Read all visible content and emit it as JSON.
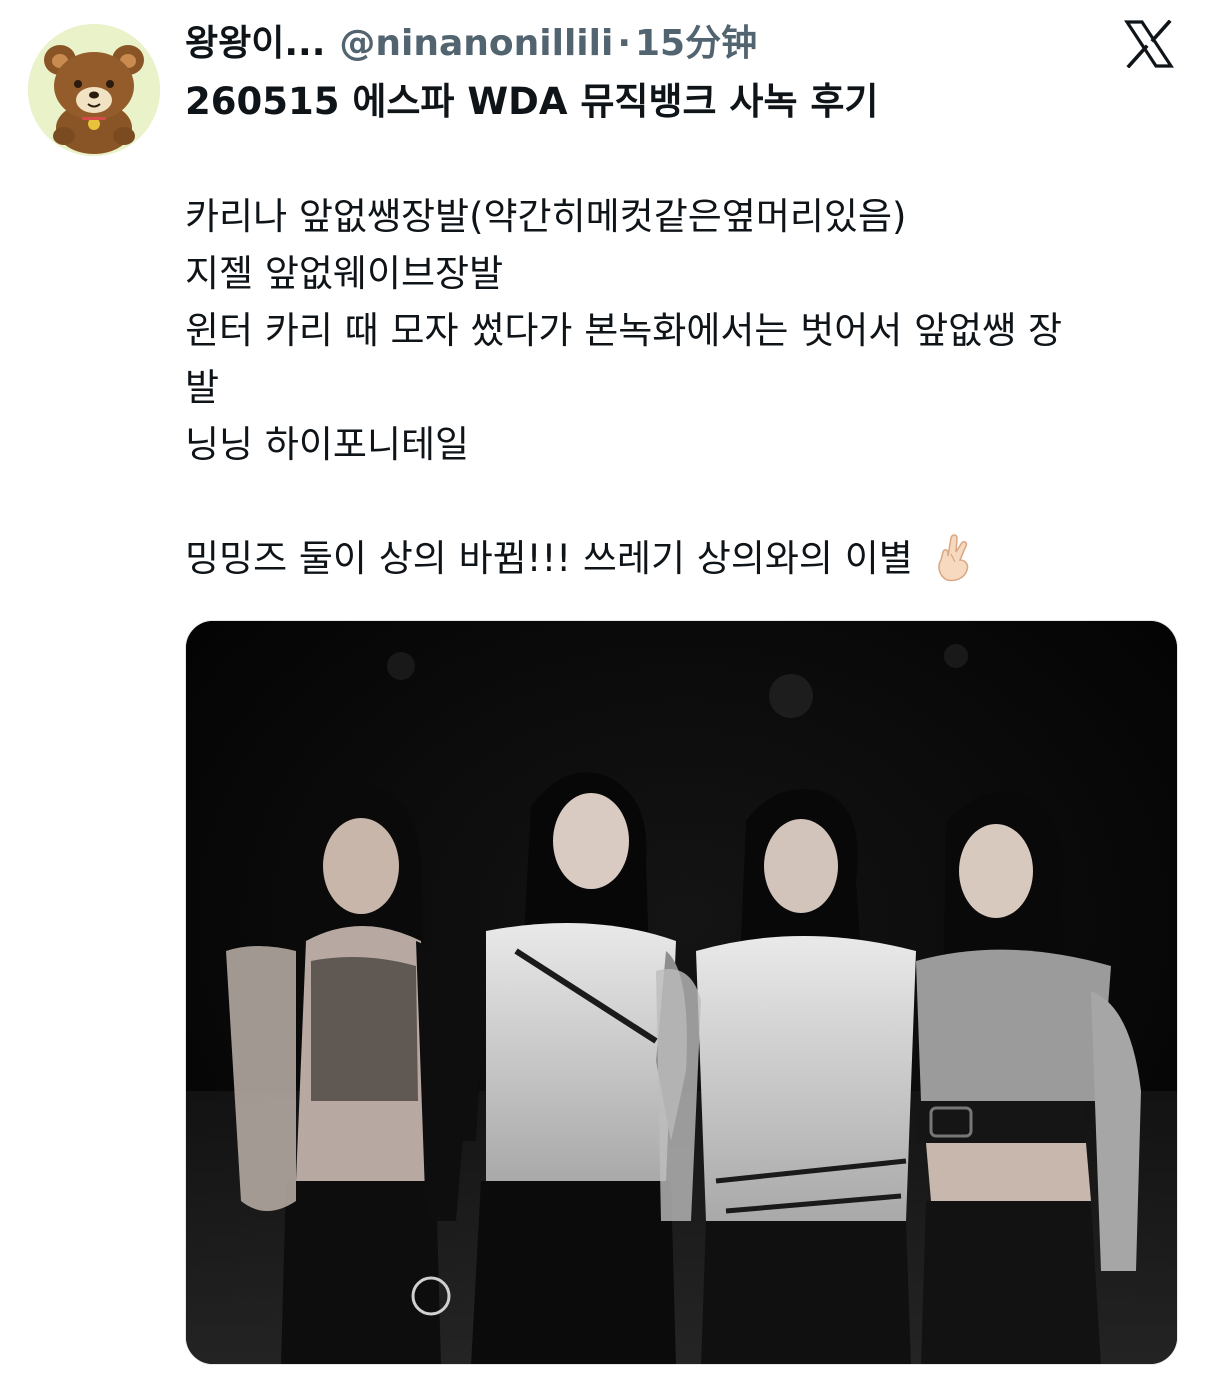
{
  "tweet": {
    "display_name": "왕왕이...",
    "handle": "@ninanonillili",
    "separator": "·",
    "time": "15分钟",
    "title": "260515 에스파 WDA 뮤직뱅크 사녹 후기",
    "lines": [
      "카리나 앞없쌩장발(약간히메컷같은옆머리있음)",
      "지젤 앞없웨이브장발",
      "윈터 카리 때 모자 썼다가 본녹화에서는 벗어서 앞없쌩 장",
      "발",
      "닝닝 하이포니테일",
      "",
      "밍밍즈 둘이 상의 바뀜!!! 쓰레기 상의와의 이별"
    ],
    "emoji": "finger-heart-emoji",
    "avatar": "bear-avatar-icon",
    "platform_logo": "x-logo-icon",
    "media": "group-photo"
  },
  "colors": {
    "text_primary": "#0f1419",
    "text_secondary": "#536471",
    "media_background": "#050505"
  }
}
